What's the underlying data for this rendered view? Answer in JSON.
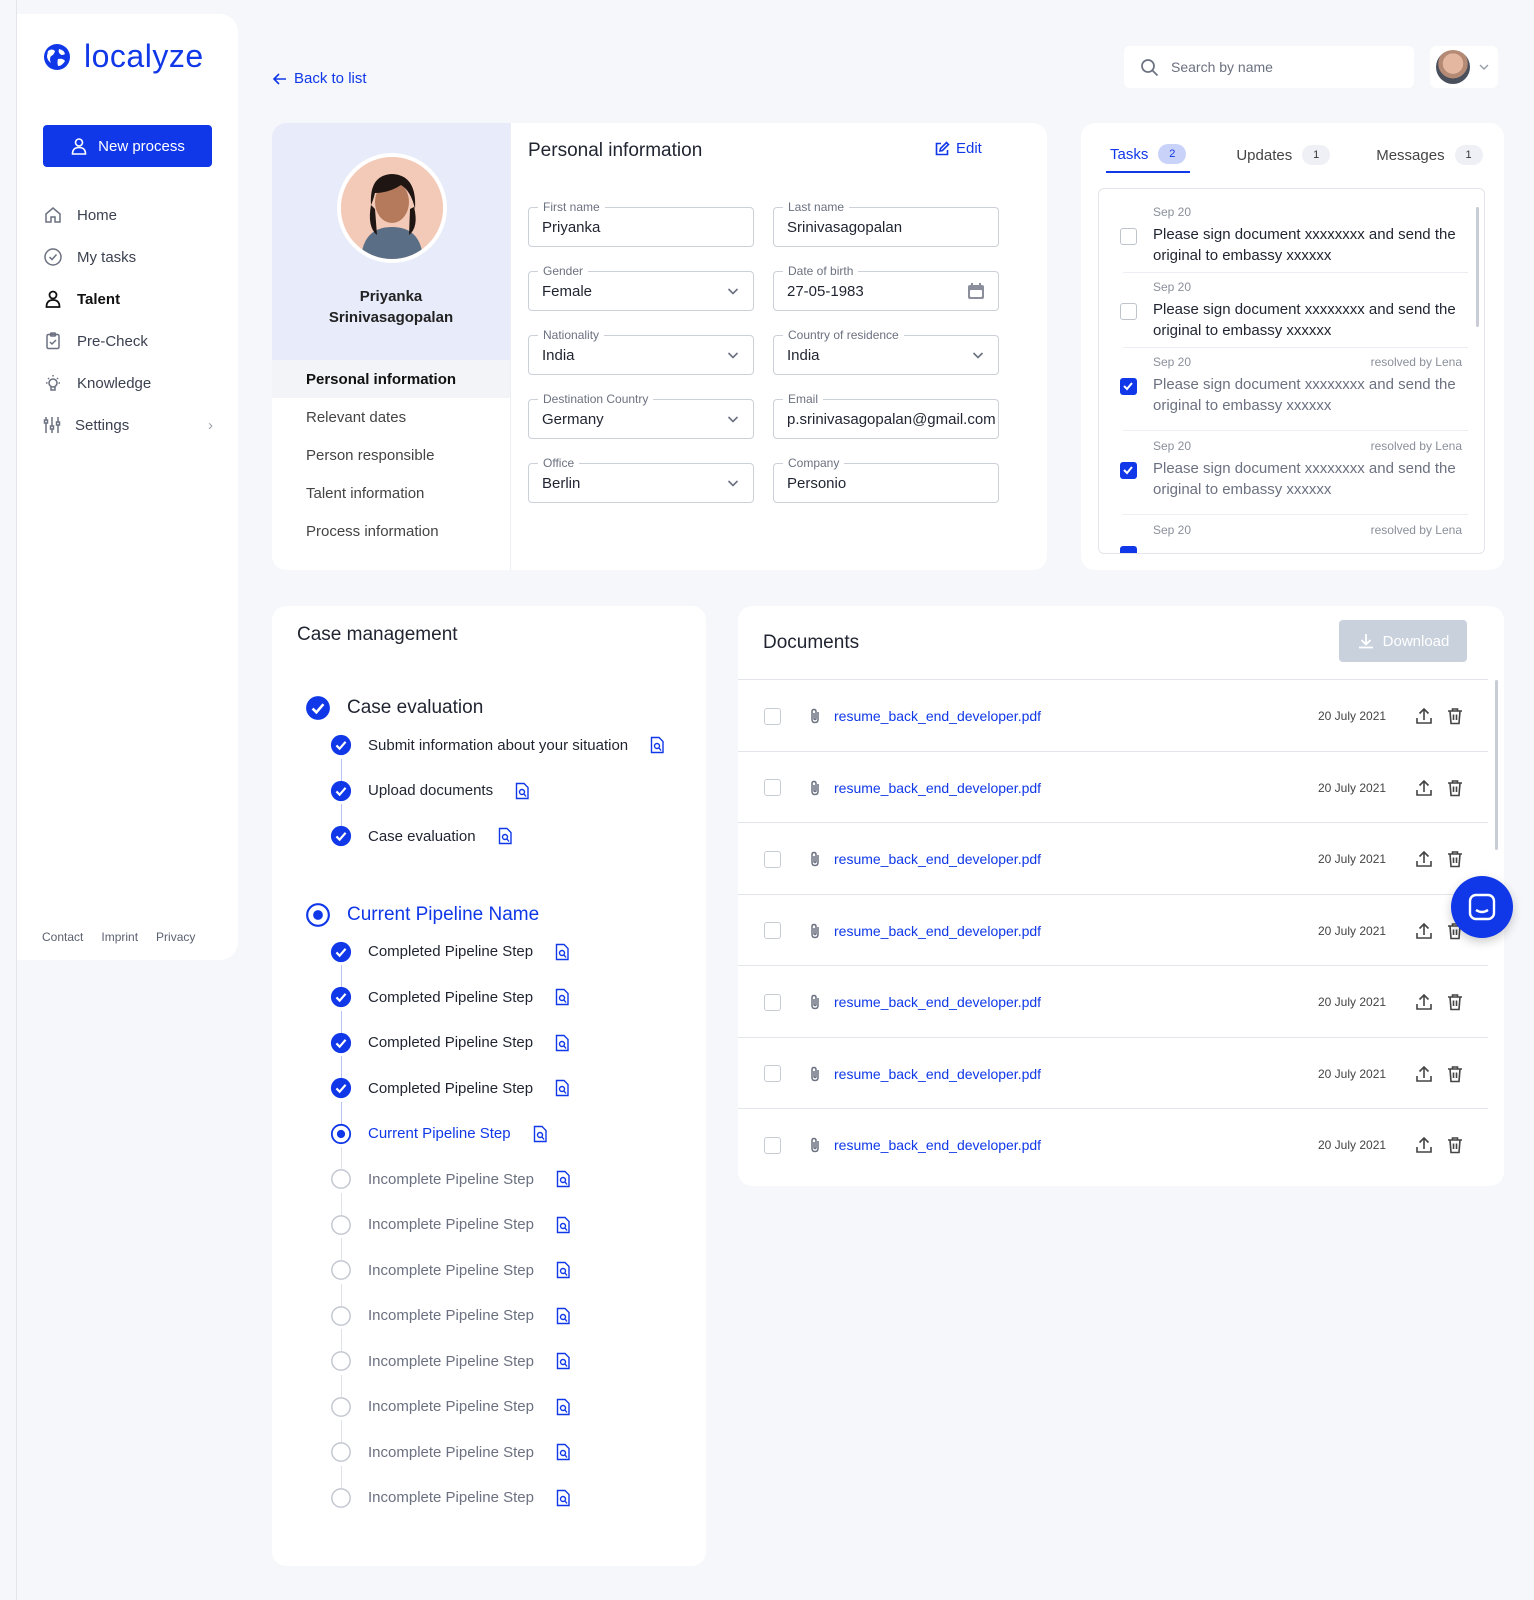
{
  "brand": {
    "name": "localyze",
    "color": "#1038e8"
  },
  "sidebar": {
    "new_process_label": "New process",
    "items": [
      {
        "label": "Home",
        "icon": "home-icon"
      },
      {
        "label": "My tasks",
        "icon": "check-circle-icon"
      },
      {
        "label": "Talent",
        "icon": "person-icon",
        "active": true
      },
      {
        "label": "Pre-Check",
        "icon": "clipboard-check-icon"
      },
      {
        "label": "Knowledge",
        "icon": "lightbulb-icon"
      },
      {
        "label": "Settings",
        "icon": "sliders-icon"
      }
    ],
    "footer": {
      "contact": "Contact",
      "imprint": "Imprint",
      "privacy": "Privacy"
    }
  },
  "header": {
    "back_label": "Back to list",
    "search_placeholder": "Search by name"
  },
  "profile": {
    "first_name": "Priyanka",
    "last_name": "Srinivasagopalan",
    "nav": [
      {
        "label": "Personal information",
        "active": true
      },
      {
        "label": "Relevant dates"
      },
      {
        "label": "Person responsible"
      },
      {
        "label": "Talent information"
      },
      {
        "label": "Process information"
      }
    ]
  },
  "personal_info": {
    "title": "Personal information",
    "edit_label": "Edit",
    "fields": {
      "first_name": {
        "label": "First name",
        "value": "Priyanka"
      },
      "last_name": {
        "label": "Last name",
        "value": "Srinivasagopalan"
      },
      "gender": {
        "label": "Gender",
        "value": "Female"
      },
      "dob": {
        "label": "Date of birth",
        "value": "27-05-1983"
      },
      "nationality": {
        "label": "Nationality",
        "value": "India"
      },
      "residence": {
        "label": "Country of residence",
        "value": "India"
      },
      "destination": {
        "label": "Destination Country",
        "value": "Germany"
      },
      "email": {
        "label": "Email",
        "value": "p.srinivasagopalan@gmail.com"
      },
      "office": {
        "label": "Office",
        "value": "Berlin"
      },
      "company": {
        "label": "Company",
        "value": "Personio"
      }
    }
  },
  "tasks_panel": {
    "tabs": [
      {
        "label": "Tasks",
        "count": "2",
        "active": true
      },
      {
        "label": "Updates",
        "count": "1"
      },
      {
        "label": "Messages",
        "count": "1"
      }
    ],
    "tasks": [
      {
        "date": "Sep 20",
        "text": "Please sign document xxxxxxxx and send the original to embassy xxxxxx",
        "done": false,
        "resolved": ""
      },
      {
        "date": "Sep 20",
        "text": "Please sign document xxxxxxxx and send the original to embassy xxxxxx",
        "done": false,
        "resolved": ""
      },
      {
        "date": "Sep 20",
        "text": "Please sign document xxxxxxxx and send the original to embassy xxxxxx",
        "done": true,
        "resolved": "resolved by Lena"
      },
      {
        "date": "Sep 20",
        "text": "Please sign document xxxxxxxx and send the original to embassy xxxxxx",
        "done": true,
        "resolved": "resolved by Lena"
      },
      {
        "date": "Sep 20",
        "text": "",
        "done": true,
        "resolved": "resolved by Lena"
      }
    ]
  },
  "case_management": {
    "title": "Case management",
    "stages": [
      {
        "name": "Case evaluation",
        "status": "completed",
        "steps": [
          {
            "label": "Submit information about your situation",
            "status": "completed"
          },
          {
            "label": "Upload documents",
            "status": "completed"
          },
          {
            "label": "Case evaluation",
            "status": "completed"
          }
        ]
      },
      {
        "name": "Current Pipeline Name",
        "status": "current",
        "steps": [
          {
            "label": "Completed Pipeline Step",
            "status": "completed"
          },
          {
            "label": "Completed Pipeline Step",
            "status": "completed"
          },
          {
            "label": "Completed Pipeline Step",
            "status": "completed"
          },
          {
            "label": "Completed Pipeline Step",
            "status": "completed"
          },
          {
            "label": "Current Pipeline Step",
            "status": "current"
          },
          {
            "label": "Incomplete Pipeline Step",
            "status": "incomplete"
          },
          {
            "label": "Incomplete Pipeline Step",
            "status": "incomplete"
          },
          {
            "label": "Incomplete Pipeline Step",
            "status": "incomplete"
          },
          {
            "label": "Incomplete Pipeline Step",
            "status": "incomplete"
          },
          {
            "label": "Incomplete Pipeline Step",
            "status": "incomplete"
          },
          {
            "label": "Incomplete Pipeline Step",
            "status": "incomplete"
          },
          {
            "label": "Incomplete Pipeline Step",
            "status": "incomplete"
          },
          {
            "label": "Incomplete Pipeline Step",
            "status": "incomplete"
          }
        ]
      }
    ]
  },
  "documents": {
    "title": "Documents",
    "download_label": "Download",
    "rows": [
      {
        "name": "resume_back_end_developer.pdf",
        "date": "20 July 2021"
      },
      {
        "name": "resume_back_end_developer.pdf",
        "date": "20 July 2021"
      },
      {
        "name": "resume_back_end_developer.pdf",
        "date": "20 July 2021"
      },
      {
        "name": "resume_back_end_developer.pdf",
        "date": "20 July 2021"
      },
      {
        "name": "resume_back_end_developer.pdf",
        "date": "20 July 2021"
      },
      {
        "name": "resume_back_end_developer.pdf",
        "date": "20 July 2021"
      },
      {
        "name": "resume_back_end_developer.pdf",
        "date": "20 July 2021"
      }
    ]
  }
}
